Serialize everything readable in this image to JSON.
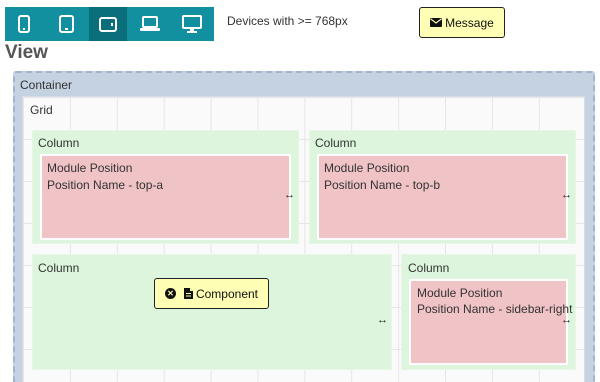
{
  "toolbar": {
    "devices_info": "Devices with >= 768px",
    "message_label": "Message"
  },
  "view": {
    "title": "View"
  },
  "layout": {
    "container_label": "Container",
    "grid_label": "Grid",
    "columns": [
      {
        "label": "Column",
        "module_title": "Module Position",
        "module_name": "Position Name - top-a"
      },
      {
        "label": "Column",
        "module_title": "Module Position",
        "module_name": "Position Name - top-b"
      },
      {
        "label": "Column",
        "component_label": "Component"
      },
      {
        "label": "Column",
        "module_title": "Module Position",
        "module_name": "Position Name - sidebar-right"
      }
    ]
  },
  "colors": {
    "device_bar": "#13909f",
    "device_active": "#0b6f7b",
    "yellow_button": "#fefeb4",
    "column_bg": "#dcf5dc",
    "module_bg": "#f0c3c6",
    "container_bg": "#c4d2e2"
  },
  "icons": [
    "phone-icon",
    "tablet-portrait-icon",
    "tablet-landscape-icon",
    "laptop-icon",
    "desktop-icon",
    "envelope-icon",
    "close-circle-icon",
    "document-icon",
    "resize-arrows-icon"
  ]
}
